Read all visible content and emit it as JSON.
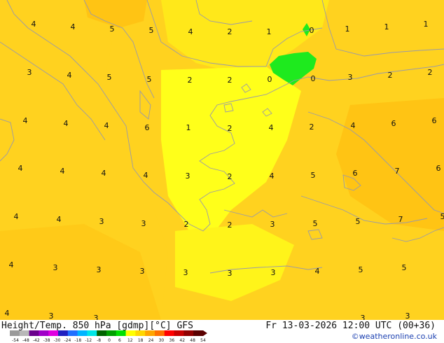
{
  "header": {
    "title": "Height/Temp. 850 hPa [gdmp][°C] GFS",
    "datetime": "Fr 13-03-2026 12:00 UTC (00+36)",
    "credit": "©weatheronline.co.uk"
  },
  "colorbar": {
    "ticks": [
      "-54",
      "-48",
      "-42",
      "-38",
      "-30",
      "-24",
      "-18",
      "-12",
      "-8",
      "0",
      "6",
      "12",
      "18",
      "24",
      "30",
      "36",
      "42",
      "48",
      "54"
    ],
    "colors": [
      "#9a9a9a",
      "#b8b8b8",
      "#6a008c",
      "#a000c8",
      "#e000e0",
      "#2020c0",
      "#2070ff",
      "#00b4ff",
      "#00e6e6",
      "#006400",
      "#00a000",
      "#00e000",
      "#ffff00",
      "#ffd700",
      "#ffa500",
      "#ff7000",
      "#ff0000",
      "#c80000",
      "#900000",
      "#5a0000"
    ]
  },
  "map": {
    "labels": [
      {
        "text": "4"
      },
      {
        "text": "4"
      },
      {
        "text": "5"
      },
      {
        "text": "5"
      },
      {
        "text": "4"
      },
      {
        "text": "2"
      },
      {
        "text": "1"
      },
      {
        "text": "0"
      },
      {
        "text": "1"
      },
      {
        "text": "1"
      },
      {
        "text": "1"
      },
      {
        "text": "3"
      },
      {
        "text": "4"
      },
      {
        "text": "5"
      },
      {
        "text": "5"
      },
      {
        "text": "2"
      },
      {
        "text": "2"
      },
      {
        "text": "0"
      },
      {
        "text": "0"
      },
      {
        "text": "3"
      },
      {
        "text": "2"
      },
      {
        "text": "2"
      },
      {
        "text": "4"
      },
      {
        "text": "4"
      },
      {
        "text": "4"
      },
      {
        "text": "6"
      },
      {
        "text": "1"
      },
      {
        "text": "2"
      },
      {
        "text": "4"
      },
      {
        "text": "2"
      },
      {
        "text": "4"
      },
      {
        "text": "6"
      },
      {
        "text": "6"
      },
      {
        "text": "4"
      },
      {
        "text": "4"
      },
      {
        "text": "4"
      },
      {
        "text": "4"
      },
      {
        "text": "3"
      },
      {
        "text": "2"
      },
      {
        "text": "4"
      },
      {
        "text": "5"
      },
      {
        "text": "6"
      },
      {
        "text": "7"
      },
      {
        "text": "6"
      },
      {
        "text": "4"
      },
      {
        "text": "4"
      },
      {
        "text": "3"
      },
      {
        "text": "3"
      },
      {
        "text": "2"
      },
      {
        "text": "2"
      },
      {
        "text": "3"
      },
      {
        "text": "5"
      },
      {
        "text": "5"
      },
      {
        "text": "7"
      },
      {
        "text": "5"
      },
      {
        "text": "4"
      },
      {
        "text": "3"
      },
      {
        "text": "3"
      },
      {
        "text": "3"
      },
      {
        "text": "3"
      },
      {
        "text": "3"
      },
      {
        "text": "3"
      },
      {
        "text": "4"
      },
      {
        "text": "5"
      },
      {
        "text": "5"
      },
      {
        "text": "4"
      },
      {
        "text": "3"
      },
      {
        "text": "3"
      },
      {
        "text": "3"
      },
      {
        "text": "3"
      },
      {
        "text": "5"
      }
    ]
  }
}
